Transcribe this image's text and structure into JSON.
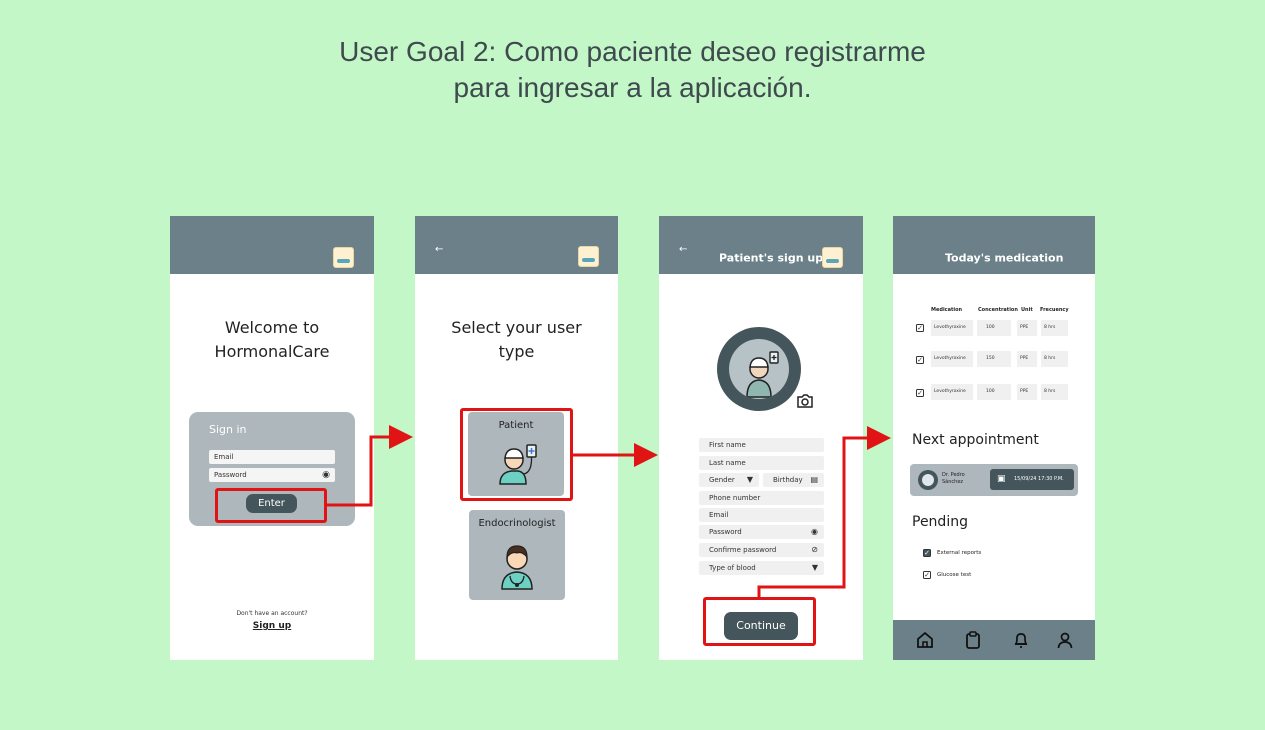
{
  "goal": {
    "line1": "User Goal 2: Como paciente deseo registrarme",
    "line2": "para ingresar a la aplicación."
  },
  "screen1": {
    "welcome_line1": "Welcome to",
    "welcome_line2": "HormonalCare",
    "signin_title": "Sign in",
    "email_placeholder": "Email",
    "password_placeholder": "Password",
    "enter_label": "Enter",
    "no_account": "Don't have an account?",
    "signup_label": "Sign up"
  },
  "screen2": {
    "back": "←",
    "title_line1": "Select your user",
    "title_line2": "type",
    "patient_label": "Patient",
    "endo_label": "Endocrinologist"
  },
  "screen3": {
    "back": "←",
    "title": "Patient's sign up",
    "fields": {
      "first_name": "First name",
      "last_name": "Last name",
      "gender": "Gender",
      "birthday": "Birthday",
      "phone": "Phone number",
      "email": "Email",
      "password": "Password",
      "confirm_password": "Confirme password",
      "blood_type": "Type of blood"
    },
    "continue_label": "Continue"
  },
  "screen4": {
    "title": "Today's medication",
    "med_headers": [
      "Medication",
      "Concentration",
      "Unit",
      "Frecuency"
    ],
    "med_rows": [
      [
        "Levothyroxine",
        "100",
        "PPE",
        "8 hrs"
      ],
      [
        "Levothyroxine",
        "150",
        "PPE",
        "8 hrs"
      ],
      [
        "Levothyroxine",
        "100",
        "PPE",
        "8 hrs"
      ]
    ],
    "next_title": "Next appointment",
    "doctor_line1": "Dr. Pedro",
    "doctor_line2": "Sánchez",
    "appt_datetime": "15/09/24 17:30 P.M.",
    "pending_title": "Pending",
    "pending_items": [
      "External reports",
      "Glucose test"
    ],
    "nav_icons": [
      "home-icon",
      "clipboard-icon",
      "bell-icon",
      "user-icon"
    ]
  },
  "colors": {
    "background": "#c3f7c7",
    "topbar": "#6b8088",
    "card": "#aeb7bc",
    "dark_button": "#44555b",
    "highlight": "#e01414"
  }
}
